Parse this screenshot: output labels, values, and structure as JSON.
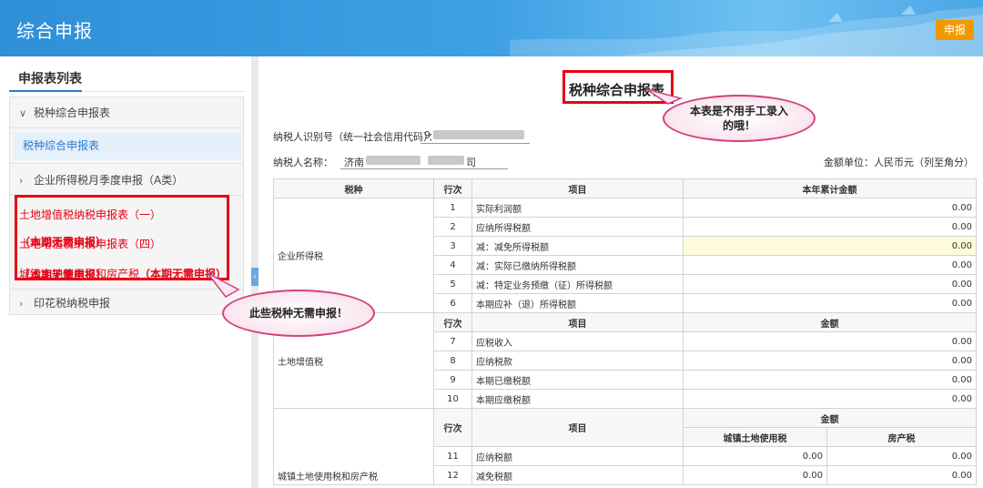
{
  "header": {
    "title": "综合申报",
    "action_label": "申报"
  },
  "sidebar": {
    "title": "申报表列表",
    "group1": "税种综合申报表",
    "group1_sub": "税种综合申报表",
    "group2": "企业所得税月季度申报（A类）",
    "red_items": [
      {
        "label": "土地增值税纳税申报表（一）",
        "note": "（本期无需申报）"
      },
      {
        "label": "土地增值税纳税申报表（四）",
        "note": "（本期无需申报）"
      },
      {
        "label": "城镇土地使用税和房产税",
        "note": "（本期无需申报）"
      }
    ],
    "group3": "印花税纳税申报"
  },
  "bubbles": {
    "top": "本表是不用手工录入的哦！",
    "left": "此些税种无需申报！"
  },
  "form": {
    "title": "税种综合申报表",
    "taxpayer_id_label": "纳税人识别号（统一社会信用代码）：",
    "taxpayer_id_value": "9",
    "taxpayer_name_label": "纳税人名称：",
    "taxpayer_name_value_start": "济南",
    "taxpayer_name_value_end": "司",
    "unit_label": "金额单位：人民币元（列至角分）"
  },
  "table": {
    "head": {
      "tax": "税种",
      "row": "行次",
      "item": "项目",
      "amount": "本年累计金额"
    },
    "s1_name": "企业所得税",
    "s1": [
      {
        "row": "1",
        "item": "实际利润额",
        "amount": "0.00"
      },
      {
        "row": "2",
        "item": "应纳所得税额",
        "amount": "0.00"
      },
      {
        "row": "3",
        "item": "减：减免所得税额",
        "amount": "0.00"
      },
      {
        "row": "4",
        "item": "减：实际已缴纳所得税额",
        "amount": "0.00"
      },
      {
        "row": "5",
        "item": "减：特定业务预缴（征）所得税额",
        "amount": "0.00"
      },
      {
        "row": "6",
        "item": "本期应补（退）所得税额",
        "amount": "0.00"
      }
    ],
    "s2_head": {
      "row": "行次",
      "item": "项目",
      "amount": "金额"
    },
    "s2_name": "土地增值税",
    "s2": [
      {
        "row": "7",
        "item": "应税收入",
        "amount": "0.00"
      },
      {
        "row": "8",
        "item": "应纳税款",
        "amount": "0.00"
      },
      {
        "row": "9",
        "item": "本期已缴税额",
        "amount": "0.00"
      },
      {
        "row": "10",
        "item": "本期应缴税额",
        "amount": "0.00"
      }
    ],
    "s3_head": {
      "row": "行次",
      "item": "项目",
      "amount": "金额",
      "col1": "城镇土地使用税",
      "col2": "房产税"
    },
    "s3_name": "城镇土地使用税和房产税",
    "s3": [
      {
        "row": "11",
        "item": "应纳税额",
        "a": "0.00",
        "b": "0.00"
      },
      {
        "row": "12",
        "item": "减免税额",
        "a": "0.00",
        "b": "0.00"
      }
    ]
  }
}
